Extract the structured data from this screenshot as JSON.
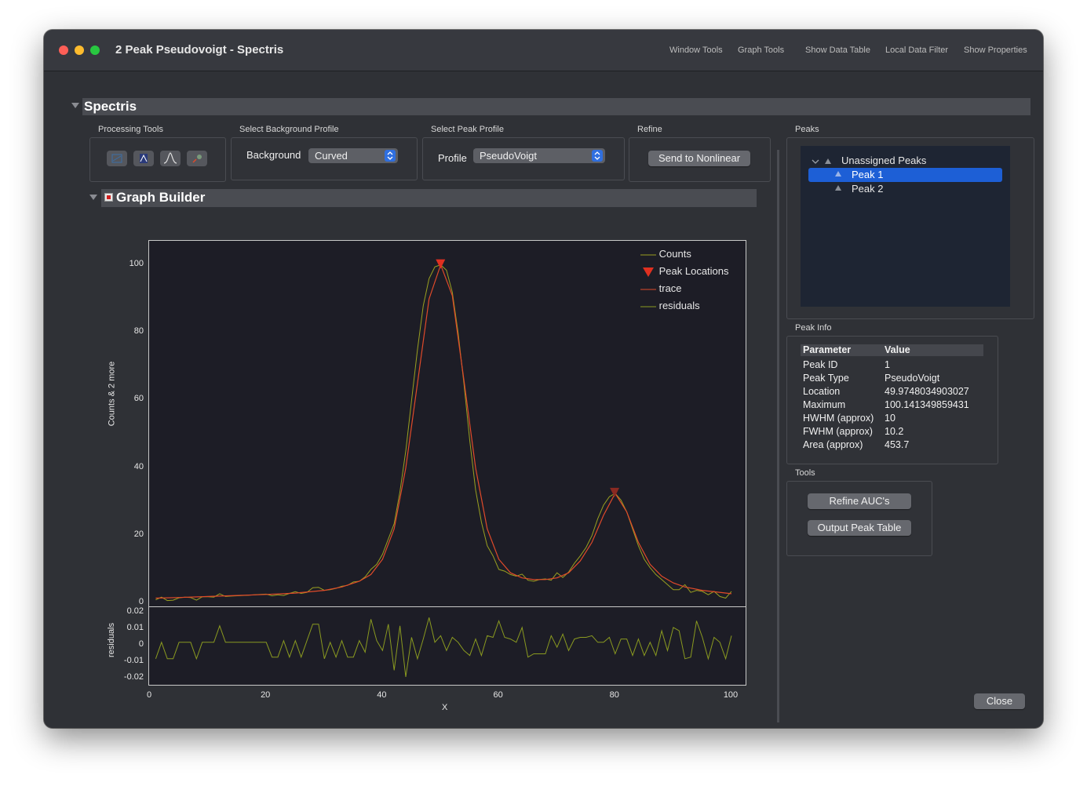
{
  "window": {
    "title": "2 Peak Pseudovoigt - Spectris",
    "menu": [
      "Window Tools",
      "Graph Tools",
      "Show Data Table",
      "Local Data Filter",
      "Show Properties"
    ],
    "traffic_colors": [
      "#fe5f57",
      "#febc2e",
      "#28c840"
    ]
  },
  "section_title": "Spectris",
  "processing": {
    "processing_tools_label": "Processing Tools",
    "background_section_label": "Select Background Profile",
    "background_label": "Background",
    "background_value": "Curved",
    "peak_section_label": "Select Peak Profile",
    "profile_label": "Profile",
    "profile_value": "PseudoVoigt",
    "refine_section_label": "Refine",
    "send_button": "Send to Nonlinear"
  },
  "graph_builder": {
    "title": "Graph Builder"
  },
  "chart_data": {
    "type": "line",
    "xlabel": "X",
    "ylabel_main": "Counts & 2 more",
    "ylabel_residuals": "residuals",
    "xlim": [
      0,
      100
    ],
    "ylim_main": [
      0,
      100
    ],
    "ylim_residuals": [
      -0.022,
      0.023
    ],
    "x_ticks": [
      "0",
      "20",
      "40",
      "60",
      "80",
      "100"
    ],
    "y_ticks_main": [
      "0",
      "20",
      "40",
      "60",
      "80",
      "100"
    ],
    "y_ticks_residuals": [
      "0.02",
      "0.01",
      "0",
      "-0.01",
      "-0.02"
    ],
    "legend": [
      {
        "name": "Counts",
        "color": "#9aa020",
        "marker": "line"
      },
      {
        "name": "Peak Locations",
        "color": "#e03020",
        "marker": "triangle-down"
      },
      {
        "name": "trace",
        "color": "#e04a2a",
        "marker": "line"
      },
      {
        "name": "residuals",
        "color": "#8a9a20",
        "marker": "line"
      }
    ],
    "peaks": [
      {
        "x": 49.97,
        "y": 100.1
      },
      {
        "x": 79.9,
        "y": 32.5
      }
    ],
    "counts": {
      "x": [
        1,
        2,
        3,
        4,
        5,
        6,
        7,
        8,
        9,
        10,
        11,
        12,
        13,
        14,
        15,
        16,
        17,
        18,
        19,
        20,
        21,
        22,
        23,
        24,
        25,
        26,
        27,
        28,
        29,
        30,
        31,
        32,
        33,
        34,
        35,
        36,
        37,
        38,
        39,
        40,
        41,
        42,
        43,
        44,
        45,
        46,
        47,
        48,
        49,
        50,
        51,
        52,
        53,
        54,
        55,
        56,
        57,
        58,
        59,
        60,
        61,
        62,
        63,
        64,
        65,
        66,
        67,
        68,
        69,
        70,
        71,
        72,
        73,
        74,
        75,
        76,
        77,
        78,
        79,
        80,
        81,
        82,
        83,
        84,
        85,
        86,
        87,
        88,
        89,
        90,
        91,
        92,
        93,
        94,
        95,
        96,
        97,
        98,
        99,
        100
      ],
      "y": [
        1.0,
        1.8,
        0.8,
        0.9,
        1.6,
        1.8,
        1.7,
        0.9,
        1.9,
        1.9,
        1.8,
        2.8,
        2.0,
        2.1,
        2.2,
        2.3,
        2.4,
        2.5,
        2.6,
        2.7,
        2.2,
        2.5,
        2.3,
        2.9,
        3.4,
        2.9,
        3.2,
        4.6,
        4.7,
        3.8,
        4.0,
        4.4,
        5.0,
        5.3,
        6.3,
        6.5,
        7.8,
        10.0,
        11.5,
        14.5,
        19.0,
        23.5,
        33.0,
        45.0,
        60.0,
        75.0,
        88.0,
        96.0,
        99.5,
        100.1,
        98.5,
        92.0,
        80.0,
        65.0,
        48.0,
        33.5,
        24.0,
        17.0,
        14.0,
        10.0,
        9.5,
        8.5,
        8.0,
        8.6,
        6.8,
        6.5,
        7.0,
        7.2,
        6.8,
        9.0,
        7.6,
        9.2,
        11.8,
        14.0,
        16.5,
        20.0,
        25.0,
        29.0,
        31.5,
        32.5,
        30.5,
        27.0,
        22.0,
        17.0,
        13.0,
        10.5,
        8.5,
        7.0,
        5.5,
        4.0,
        4.0,
        5.5,
        3.2,
        3.8,
        3.5,
        2.5,
        3.5,
        2.0,
        1.5,
        3.5
      ]
    },
    "trace": {
      "x": [
        1,
        5,
        10,
        15,
        20,
        25,
        30,
        33,
        36,
        38,
        40,
        42,
        44,
        46,
        48,
        50,
        52,
        54,
        56,
        58,
        60,
        62,
        64,
        66,
        68,
        70,
        72,
        74,
        76,
        78,
        80,
        82,
        84,
        86,
        88,
        90,
        92,
        95,
        100
      ],
      "y": [
        1.5,
        1.7,
        2.0,
        2.3,
        2.6,
        3.0,
        3.8,
        4.8,
        6.5,
        8.5,
        13.0,
        22.0,
        40.0,
        65.0,
        90.0,
        100.1,
        91.0,
        66.0,
        40.0,
        22.0,
        13.0,
        9.0,
        7.5,
        7.0,
        7.0,
        7.5,
        9.0,
        12.5,
        18.0,
        26.0,
        32.5,
        27.0,
        18.0,
        11.5,
        8.0,
        6.0,
        4.8,
        3.8,
        2.8
      ]
    },
    "residuals": {
      "x": [
        1,
        2,
        3,
        4,
        5,
        6,
        7,
        8,
        9,
        10,
        11,
        12,
        13,
        14,
        15,
        16,
        17,
        18,
        19,
        20,
        21,
        22,
        23,
        24,
        25,
        26,
        27,
        28,
        29,
        30,
        31,
        32,
        33,
        34,
        35,
        36,
        37,
        38,
        39,
        40,
        41,
        42,
        43,
        44,
        45,
        46,
        47,
        48,
        49,
        50,
        51,
        52,
        53,
        54,
        55,
        56,
        57,
        58,
        59,
        60,
        61,
        62,
        63,
        64,
        65,
        66,
        67,
        68,
        69,
        70,
        71,
        72,
        73,
        74,
        75,
        76,
        77,
        78,
        79,
        80,
        81,
        82,
        83,
        84,
        85,
        86,
        87,
        88,
        89,
        90,
        91,
        92,
        93,
        94,
        95,
        96,
        97,
        98,
        99,
        100
      ],
      "y": [
        -0.008,
        0.002,
        -0.008,
        -0.008,
        0.002,
        0.002,
        0.002,
        -0.008,
        0.002,
        0.002,
        0.002,
        0.012,
        0.002,
        0.002,
        0.002,
        0.002,
        0.002,
        0.002,
        0.002,
        0.002,
        -0.007,
        -0.007,
        0.003,
        -0.007,
        0.003,
        -0.007,
        0.003,
        0.013,
        0.013,
        -0.008,
        0.002,
        -0.007,
        0.003,
        -0.007,
        -0.007,
        0.003,
        -0.004,
        0.016,
        0.003,
        -0.003,
        0.013,
        -0.015,
        0.012,
        -0.019,
        0.005,
        -0.008,
        0.004,
        0.017,
        0.002,
        0.006,
        -0.003,
        0.005,
        0.002,
        -0.003,
        -0.006,
        0.004,
        -0.006,
        0.006,
        0.005,
        0.015,
        0.005,
        0.004,
        0.002,
        0.011,
        -0.007,
        -0.005,
        -0.005,
        -0.005,
        0.006,
        -0.001,
        0.007,
        -0.003,
        0.004,
        0.005,
        0.005,
        0.006,
        0.002,
        0.002,
        0.005,
        -0.005,
        0.004,
        0.004,
        -0.006,
        0.004,
        -0.006,
        0.002,
        -0.006,
        0.009,
        -0.003,
        0.011,
        0.009,
        -0.008,
        -0.007,
        0.015,
        0.005,
        -0.008,
        0.005,
        0.002,
        -0.008,
        0.006
      ]
    }
  },
  "peaks_panel": {
    "label": "Peaks",
    "tree_root": "Unassigned Peaks",
    "items": [
      "Peak 1",
      "Peak 2"
    ]
  },
  "peak_info": {
    "label": "Peak Info",
    "headers": [
      "Parameter",
      "Value"
    ],
    "rows": [
      [
        "Peak ID",
        "1"
      ],
      [
        "Peak Type",
        "PseudoVoigt"
      ],
      [
        "Location",
        "49.9748034903027"
      ],
      [
        "Maximum",
        "100.141349859431"
      ],
      [
        "HWHM (approx)",
        "10"
      ],
      [
        "FWHM (approx)",
        "10.2"
      ],
      [
        "Area (approx)",
        "453.7"
      ]
    ]
  },
  "tools_panel": {
    "label": "Tools",
    "refine_button": "Refine AUC's",
    "output_button": "Output Peak Table"
  },
  "close_button": "Close",
  "colors": {
    "selection": "#1d5fd6",
    "counts_line": "#9aa020",
    "trace_line": "#e04a2a",
    "peak_marker": "#e03020"
  }
}
